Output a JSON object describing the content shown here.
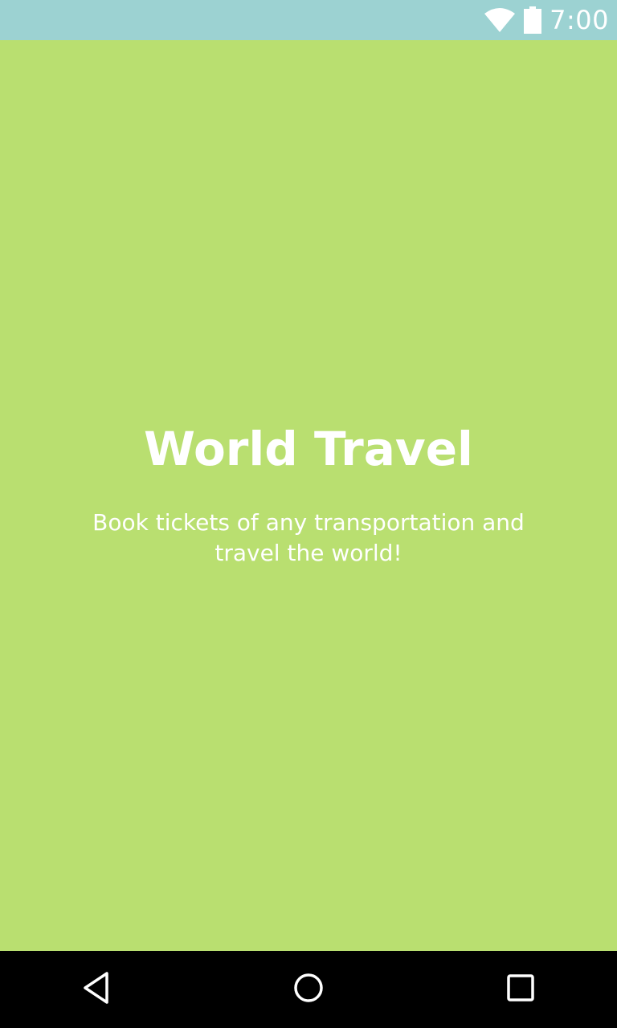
{
  "status_bar": {
    "time": "7:00",
    "icons": [
      "wifi-icon",
      "battery-icon"
    ],
    "background": "#9cd2d2"
  },
  "screen": {
    "background": "#b9df70",
    "title": "World Travel",
    "subtitle": "Book tickets of any transportation and travel the world!"
  },
  "nav_bar": {
    "background": "#000000",
    "buttons": [
      "back-icon",
      "home-icon",
      "recents-icon"
    ]
  }
}
